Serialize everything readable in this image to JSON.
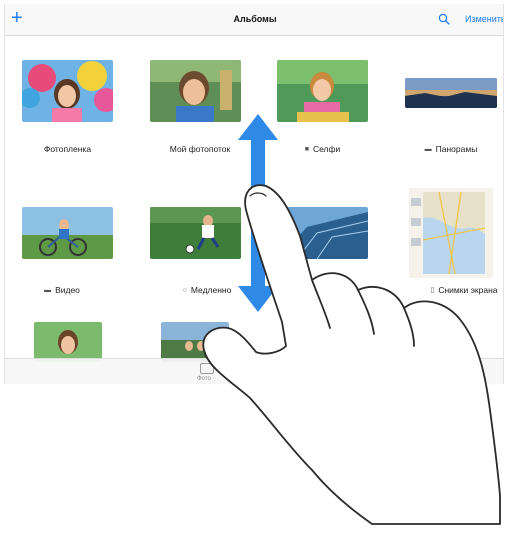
{
  "navbar": {
    "add_icon": "plus-icon",
    "title": "Альбомы",
    "search_icon": "search-icon",
    "edit_label": "Изменить",
    "accent_color": "#1e7cf2"
  },
  "albums": {
    "camera_roll": {
      "label": "Фотопленка"
    },
    "photo_stream": {
      "label": "Мой фотопоток"
    },
    "selfies": {
      "label": "Селфи",
      "icon": "camera-icon"
    },
    "panoramas": {
      "label": "Панорамы",
      "icon": "panorama-icon"
    },
    "videos": {
      "label": "Видео",
      "icon": "video-icon"
    },
    "slo_mo": {
      "label": "Медленно",
      "icon": "slo-mo-icon"
    },
    "screenshots": {
      "label": "Снимки экрана",
      "icon": "screenshot-icon"
    }
  },
  "tabbar": {
    "photos_label": "Фото"
  },
  "gesture": {
    "arrow_color": "#2e8ae6",
    "description_icon": "hand-swipe-icon"
  }
}
